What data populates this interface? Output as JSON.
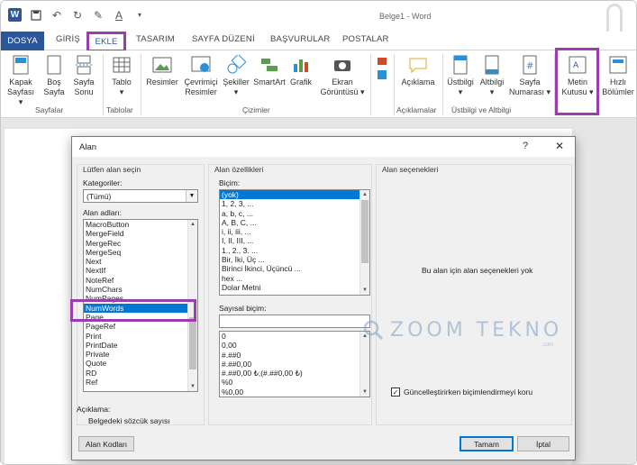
{
  "app": {
    "window_title": "Belge1 - Word",
    "logo_letter": "W"
  },
  "tabs": [
    "DOSYA",
    "GİRİŞ",
    "EKLE",
    "TASARIM",
    "SAYFA DÜZENİ",
    "BAŞVURULAR",
    "POSTALAR"
  ],
  "ribbon": {
    "buttons": [
      {
        "line1": "Kapak",
        "line2": "Sayfası ▾"
      },
      {
        "line1": "Boş",
        "line2": "Sayfa"
      },
      {
        "line1": "Sayfa",
        "line2": "Sonu"
      },
      {
        "line1": "Tablo",
        "line2": "▾"
      },
      {
        "line1": "Resimler",
        "line2": ""
      },
      {
        "line1": "Çevrimiçi",
        "line2": "Resimler"
      },
      {
        "line1": "Şekiller",
        "line2": "▾"
      },
      {
        "line1": "SmartArt",
        "line2": ""
      },
      {
        "line1": "Grafik",
        "line2": ""
      },
      {
        "line1": "Ekran",
        "line2": "Görüntüsü ▾"
      },
      {
        "line1": "Açıklama",
        "line2": ""
      },
      {
        "line1": "Üstbilgi",
        "line2": "▾"
      },
      {
        "line1": "Altbilgi",
        "line2": "▾"
      },
      {
        "line1": "Sayfa",
        "line2": "Numarası ▾"
      },
      {
        "line1": "Metin",
        "line2": "Kutusu ▾"
      },
      {
        "line1": "Hızlı",
        "line2": "Bölümler"
      }
    ],
    "groups": [
      "Sayfalar",
      "Tablolar",
      "Çizimler",
      "Açıklamalar",
      "Üstbilgi ve Altbilgi"
    ]
  },
  "dialog": {
    "title": "Alan",
    "help": "?",
    "close": "✕",
    "left_panel_title": "Lütfen alan seçin",
    "categories_label": "Kategoriler:",
    "categories_value": "(Tümü)",
    "field_names_label": "Alan adları:",
    "field_names": [
      "MacroButton",
      "MergeField",
      "MergeRec",
      "MergeSeq",
      "Next",
      "NextIf",
      "NoteRef",
      "NumChars",
      "NumPages",
      "NumWords",
      "Page",
      "PageRef",
      "Print",
      "PrintDate",
      "Private",
      "Quote",
      "RD",
      "Ref"
    ],
    "selected_field": "NumWords",
    "description_label": "Açıklama:",
    "description_text": "Belgedeki sözcük sayısı",
    "field_codes_button": "Alan Kodları",
    "middle_panel_title": "Alan özellikleri",
    "format_label": "Biçim:",
    "formats": [
      "(yok)",
      "1, 2, 3, ...",
      "a, b, c, ...",
      "A, B, C, ...",
      "i, ii, iii, ...",
      "I, II, III, ...",
      "1., 2., 3. ...",
      "Bir, İki, Üç ...",
      "Birinci İkinci, Üçüncü ...",
      "hex ...",
      "Dolar Metni"
    ],
    "selected_format": "(yok)",
    "numeric_format_label": "Sayısal biçim:",
    "numeric_format_value": "",
    "numeric_formats": [
      "0",
      "0,00",
      "#.##0",
      "#.##0,00",
      "#.##0,00 ₺;(#.##0,00 ₺)",
      "%0",
      "%0,00"
    ],
    "right_panel_title": "Alan seçenekleri",
    "no_options_text": "Bu alan için alan seçenekleri yok",
    "preserve_label": "Güncelleştirirken biçimlendirmeyi koru",
    "preserve_checked": "✓",
    "ok_button": "Tamam",
    "cancel_button": "İptal"
  },
  "watermark": {
    "text": "ZOOM TEKNO",
    "sub": ".com"
  },
  "colors": {
    "word_blue": "#2b579a",
    "highlight": "#9b3dad",
    "selection": "#0078d7"
  }
}
